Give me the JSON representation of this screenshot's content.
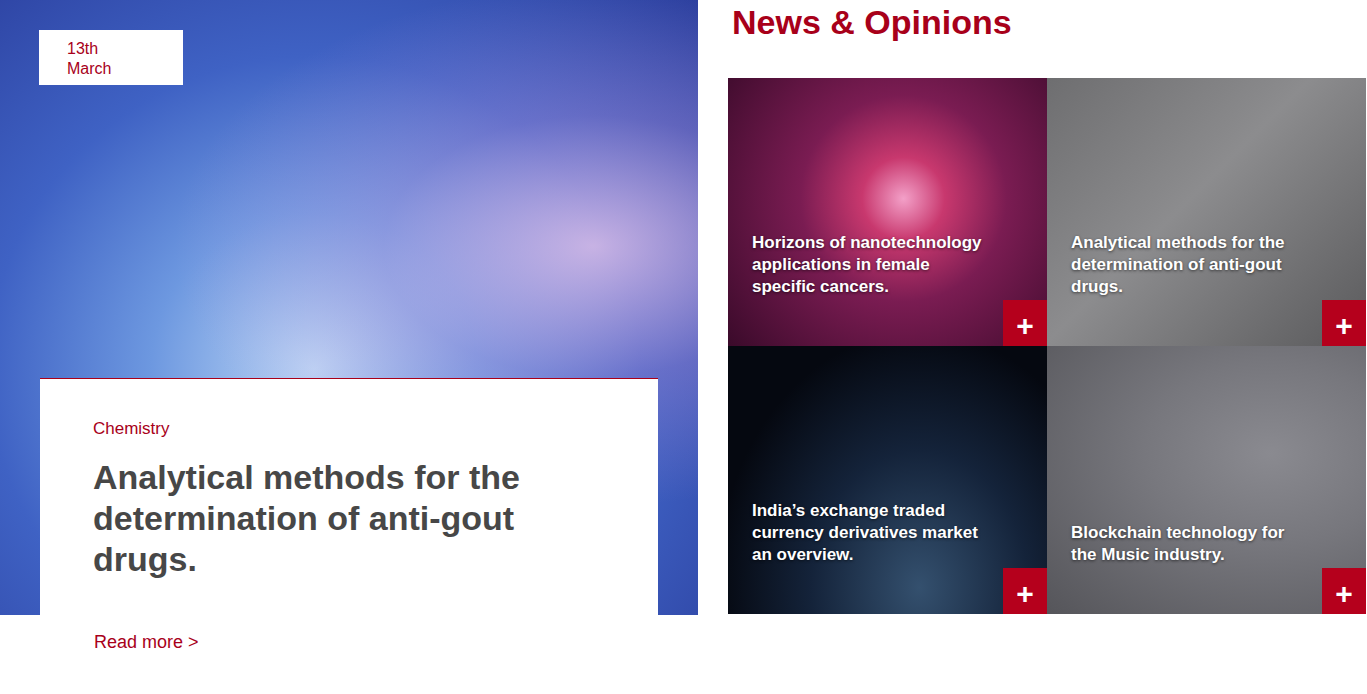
{
  "featured": {
    "date": "13th March",
    "category": "Chemistry",
    "title": "Analytical methods for the determination of anti-gout drugs.",
    "link": "Read more >"
  },
  "news": {
    "heading": "News & Opinions",
    "items": [
      {
        "title": "Horizons of nanotechnology applications in female specific cancers.",
        "button": "+"
      },
      {
        "title": "Analytical methods for the determination of anti-gout drugs.",
        "button": "+"
      },
      {
        "title": "India’s exchange traded currency derivatives market an overview.",
        "button": "+"
      },
      {
        "title": "Blockchain technology for the Music industry.",
        "button": "+"
      }
    ]
  }
}
